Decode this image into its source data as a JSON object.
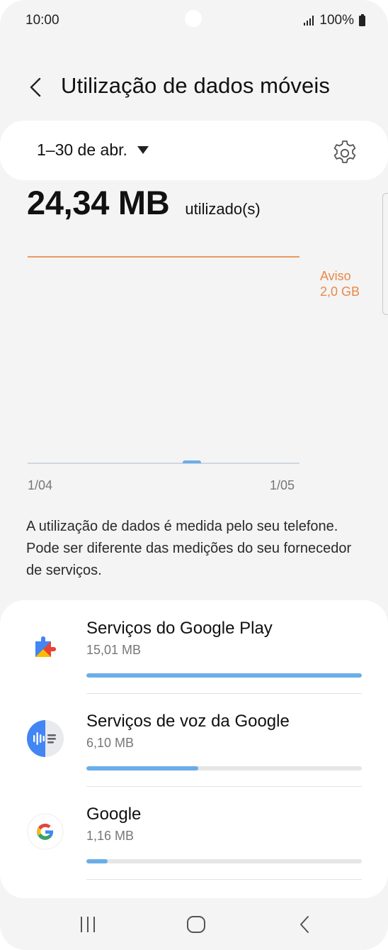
{
  "status_bar": {
    "time": "10:00",
    "battery_text": "100%"
  },
  "header": {
    "title": "Utilização de dados móveis"
  },
  "period": {
    "label": "1–30 de abr."
  },
  "usage": {
    "value": "24,34 MB",
    "unit": "utilizado(s)"
  },
  "chart": {
    "warning_label_line1": "Aviso",
    "warning_label_line2": "2,0 GB",
    "x_start": "1/04",
    "x_end": "1/05"
  },
  "note": "A utilização de dados é medida pelo seu telefone. Pode ser diferente das medições do seu fornecedor de serviços.",
  "apps": [
    {
      "name": "Serviços do Google Play",
      "size": "15,01 MB",
      "fraction": 1.0,
      "icon": "google-play-services-icon"
    },
    {
      "name": "Serviços de voz da Google",
      "size": "6,10 MB",
      "fraction": 0.406,
      "icon": "google-voice-services-icon"
    },
    {
      "name": "Google",
      "size": "1,16 MB",
      "fraction": 0.077,
      "icon": "google-icon"
    }
  ],
  "colors": {
    "accent_bar": "#6aaee8",
    "warning": "#e8894a"
  }
}
